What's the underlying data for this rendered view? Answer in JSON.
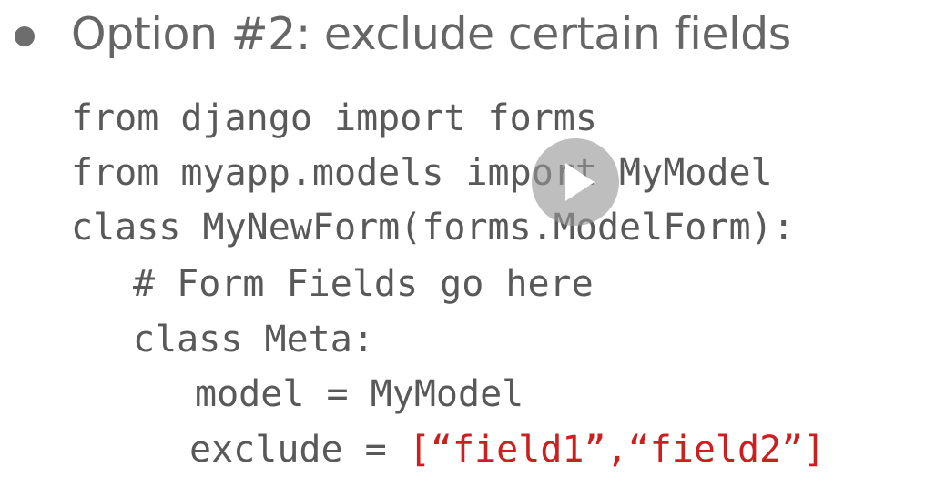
{
  "slide": {
    "heading": "Option #2: exclude certain fields",
    "code_lines": [
      "from django import forms",
      "from myapp.models import MyModel",
      "class MyNewForm(forms.ModelForm):",
      "# Form Fields go here",
      "class Meta:",
      "model = MyModel",
      "exclude = "
    ],
    "exclude_value": "[“field1”,“field2”]"
  },
  "video": {
    "play_icon": "play-icon"
  },
  "colors": {
    "heading": "#666666",
    "code": "#595959",
    "highlight": "#cc1f1f",
    "play_overlay": "#969696"
  }
}
